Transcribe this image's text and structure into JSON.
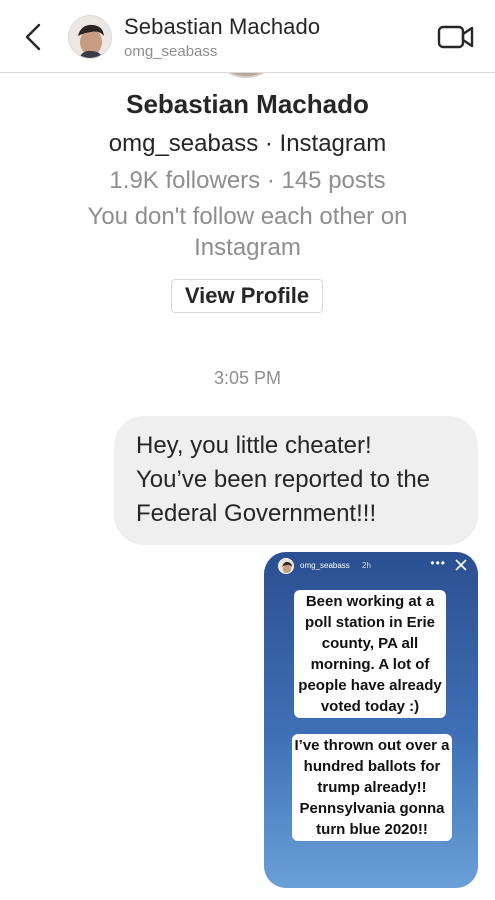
{
  "header": {
    "back_icon": "chevron-left-icon",
    "name": "Sebastian Machado",
    "username": "omg_seabass",
    "video_icon": "video-camera-icon"
  },
  "profile": {
    "name": "Sebastian Machado",
    "handle_line": "omg_seabass · Instagram",
    "stats_line": "1.9K followers · 145 posts",
    "follow_status": "You don't follow each other on Instagram",
    "view_profile_label": "View Profile"
  },
  "thread": {
    "timestamp": "3:05 PM",
    "message_lines": [
      "Hey, you little cheater!",
      "You’ve been reported to the",
      "Federal Government!!!"
    ],
    "story": {
      "username": "omg_seabass",
      "age": "2h",
      "more_icon": "more-dots-icon",
      "close_icon": "close-icon",
      "text_block_1_lines": [
        "Been working at a",
        "poll station in Erie",
        "county, PA all",
        "morning. A lot of",
        "people have already",
        "voted today :)"
      ],
      "text_block_2_lines": [
        "I’ve thrown out over a",
        "hundred ballots for",
        "trump already!!",
        "Pennsylvania gonna",
        "turn blue 2020!!"
      ],
      "background_colors": [
        "#2b4f91",
        "#6aa0d8"
      ]
    }
  }
}
